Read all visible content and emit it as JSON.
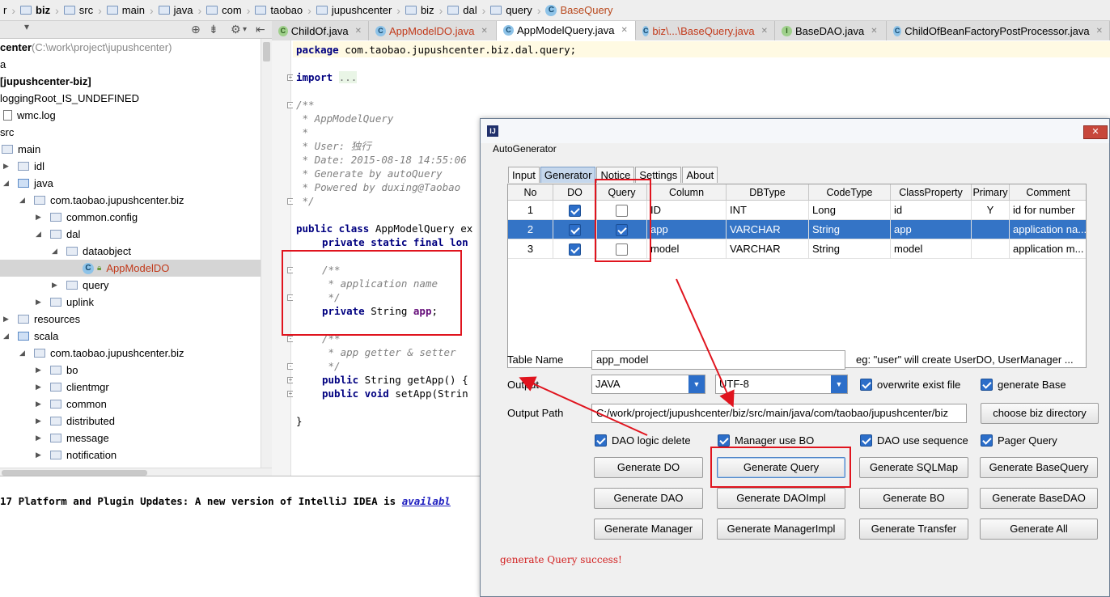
{
  "breadcrumb": [
    "r",
    "biz",
    "src",
    "main",
    "java",
    "com",
    "taobao",
    "jupushcenter",
    "biz",
    "dal",
    "query",
    "BaseQuery"
  ],
  "tabs": [
    {
      "label": "ChildOf.java",
      "icon": "class-generic-icon"
    },
    {
      "label": "AppModelDO.java",
      "icon": "class-icon"
    },
    {
      "label": "AppModelQuery.java",
      "icon": "class-icon"
    },
    {
      "label": "biz\\...\\BaseQuery.java",
      "icon": "class-icon"
    },
    {
      "label": "BaseDAO.java",
      "icon": "interface-icon"
    },
    {
      "label": "ChildOfBeanFactoryPostProcessor.java",
      "icon": "class-icon"
    }
  ],
  "tree": [
    {
      "label": "center",
      "suffix": " (C:\\work\\project\\jupushcenter)"
    },
    {
      "label": "a"
    },
    {
      "label": "[jupushcenter-biz]"
    },
    {
      "label": "loggingRoot_IS_UNDEFINED"
    },
    {
      "label": "wmc.log"
    },
    {
      "label": "src"
    },
    {
      "label": "main"
    },
    {
      "label": "idl"
    },
    {
      "label": "java"
    },
    {
      "label": "com.taobao.jupushcenter.biz"
    },
    {
      "label": "common.config"
    },
    {
      "label": "dal"
    },
    {
      "label": "dataobject"
    },
    {
      "label": "AppModelDO"
    },
    {
      "label": "query"
    },
    {
      "label": "uplink"
    },
    {
      "label": "resources"
    },
    {
      "label": "scala"
    },
    {
      "label": "com.taobao.jupushcenter.biz"
    },
    {
      "label": "bo"
    },
    {
      "label": "clientmgr"
    },
    {
      "label": "common"
    },
    {
      "label": "distributed"
    },
    {
      "label": "message"
    },
    {
      "label": "notification"
    }
  ],
  "code": {
    "l1_kw": "package",
    "l1_rest": " com.taobao.jupushcenter.biz.dal.query;",
    "l2_kw": "import",
    "l2_fold": "...",
    "c1": "/**",
    "c2": " * AppModelQuery",
    "c3": " *",
    "c4": " * User: 独行",
    "c5": " * Date: 2015-08-18 14:55:06",
    "c6": " * Generate by autoQuery",
    "c7": " * Powered by duxing@Taobao",
    "c8": " */",
    "cls_kw": "public class",
    "cls_name": " AppModelQuery ex",
    "f1_kw": "private static final",
    "f1_rest": " lon",
    "d1": "/**",
    "d2": " * application name",
    "d3": " */",
    "f2_kw": "private",
    "f2_type": " String ",
    "f2_name": "app",
    "f2_end": ";",
    "g1": "/**",
    "g2": " * app getter & setter",
    "g3": " */",
    "m1_kw": "public",
    "m1_rest": " String getApp() {",
    "m2_kw": "public void",
    "m2_rest": " setApp(Strin",
    "close": "}"
  },
  "notification": {
    "text": "17 Platform and Plugin Updates: A new version of IntelliJ IDEA is ",
    "link": "availabl"
  },
  "dialog": {
    "heading": "AutoGenerator",
    "close_label": "✕",
    "tabs": [
      "Input",
      "Generator",
      "Notice",
      "Settings",
      "About"
    ],
    "columns": [
      "No",
      "DO",
      "Query",
      "Column",
      "DBType",
      "CodeType",
      "ClassProperty",
      "Primary",
      "Comment"
    ],
    "rows": [
      {
        "no": "1",
        "do": true,
        "query": false,
        "column": "ID",
        "dbtype": "INT",
        "codetype": "Long",
        "prop": "id",
        "primary": "Y",
        "comment": "id for number"
      },
      {
        "no": "2",
        "do": true,
        "query": true,
        "column": "app",
        "dbtype": "VARCHAR",
        "codetype": "String",
        "prop": "app",
        "primary": "",
        "comment": "application na..."
      },
      {
        "no": "3",
        "do": true,
        "query": false,
        "column": "model",
        "dbtype": "VARCHAR",
        "codetype": "String",
        "prop": "model",
        "primary": "",
        "comment": "application m..."
      }
    ],
    "table_name_label": "Table Name",
    "table_name_value": "app_model",
    "table_name_hint": "eg: \"user\" will create UserDO, UserManager ...",
    "output_label": "Output",
    "output_lang": "JAVA",
    "output_encoding": "UTF-8",
    "overwrite_label": "overwrite exist file",
    "generate_base_label": "generate Base",
    "output_path_label": "Output Path",
    "output_path_value": "C:/work/project/jupushcenter/biz/src/main/java/com/taobao/jupushcenter/biz",
    "choose_dir_label": "choose biz directory",
    "options": [
      "DAO logic delete",
      "Manager use BO",
      "DAO use sequence",
      "Pager Query"
    ],
    "buttons": [
      "Generate DO",
      "Generate Query",
      "Generate SQLMap",
      "Generate BaseQuery",
      "Generate DAO",
      "Generate DAOImpl",
      "Generate BO",
      "Generate BaseDAO",
      "Generate Manager",
      "Generate ManagerImpl",
      "Generate Transfer",
      "Generate All"
    ],
    "status": "generate Query success!"
  },
  "colors": {
    "accent": "#2c6ec9",
    "selection": "#3474c6",
    "annotation_red": "#e0141e",
    "status_red": "#d21e1e"
  }
}
